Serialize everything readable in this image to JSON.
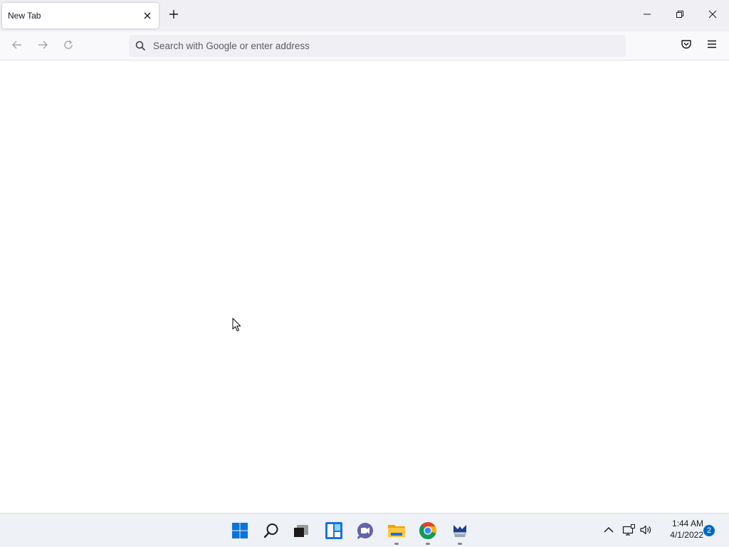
{
  "browser": {
    "tab": {
      "title": "New Tab",
      "close_icon": "close-icon"
    },
    "new_tab_icon": "plus-icon",
    "window_controls": [
      "minimize-icon",
      "restore-icon",
      "close-icon"
    ],
    "nav": {
      "back_icon": "arrow-left-icon",
      "forward_icon": "arrow-right-icon",
      "reload_icon": "reload-icon"
    },
    "urlbar": {
      "placeholder": "Search with Google or enter address",
      "value": "",
      "icon": "search-icon"
    },
    "toolbar_icons": [
      "pocket-icon",
      "hamburger-menu-icon"
    ],
    "colors": {
      "tabstrip": "#f0f0f4",
      "navbar": "#f9f9fb",
      "urlbar": "#f0f0f4",
      "text": "#15141a"
    }
  },
  "taskbar": {
    "pinned": [
      {
        "name": "windows-start-icon"
      },
      {
        "name": "search-icon"
      },
      {
        "name": "task-view-icon"
      },
      {
        "name": "widgets-icon"
      },
      {
        "name": "teams-chat-icon"
      },
      {
        "name": "file-explorer-icon",
        "running": true
      },
      {
        "name": "chrome-icon",
        "running": true
      },
      {
        "name": "app-icon",
        "running": true
      }
    ],
    "tray": {
      "icons": [
        "chevron-up-icon",
        "network-icon",
        "volume-icon"
      ],
      "time": "1:44 AM",
      "date": "4/1/2022",
      "notification_count": "2"
    },
    "accent_color": "#0067c0"
  }
}
